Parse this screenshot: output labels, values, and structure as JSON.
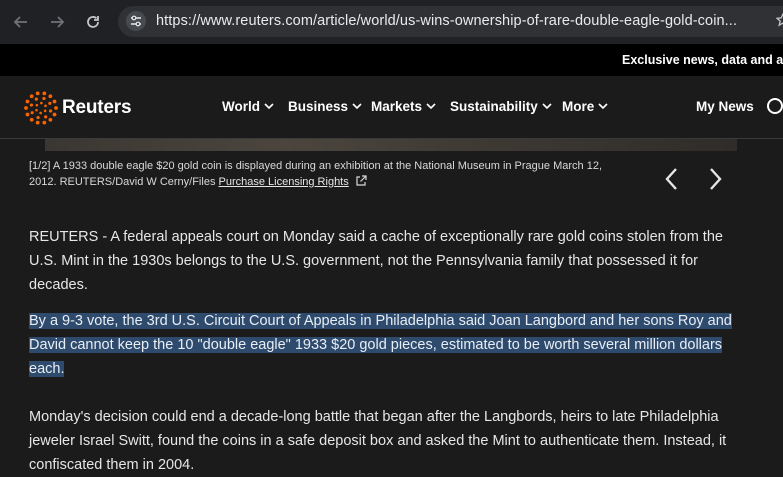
{
  "browser": {
    "url": "https://www.reuters.com/article/world/us-wins-ownership-of-rare-double-eagle-gold-coin..."
  },
  "promo": {
    "text": "Exclusive news, data and a"
  },
  "header": {
    "logo_text": "Reuters",
    "nav": [
      {
        "label": "World"
      },
      {
        "label": "Business"
      },
      {
        "label": "Markets"
      },
      {
        "label": "Sustainability"
      },
      {
        "label": "More"
      }
    ],
    "my_news": "My News"
  },
  "caption": {
    "text": "[1/2] A 1933 double eagle $20 gold coin is displayed during an exhibition at the National Museum in Prague March 12, 2012. REUTERS/David W Cerny/Files ",
    "link": "Purchase Licensing Rights"
  },
  "article": {
    "p1": "REUTERS - A federal appeals court on Monday said a cache of exceptionally rare gold coins stolen from the U.S. Mint in the 1930s belongs to the U.S. government, not the Pennsylvania family that possessed it for decades.",
    "p2": "By a 9-3 vote, the 3rd U.S. Circuit Court of Appeals in Philadelphia said Joan Langbord and her sons Roy and David cannot keep the 10 \"double eagle\" 1933 $20 gold pieces, estimated to be worth several million dollars each.",
    "p3": "Monday's decision could end a decade-long battle that began after the Langbords, heirs to late Philadelphia jeweler Israel Switt, found the coins in a safe deposit box and asked the Mint to authenticate them. Instead, it confiscated them in 2004."
  },
  "colors": {
    "page_bg": "#1b1b1b",
    "selection": "#2e4a6c",
    "brand_orange": "#fa6400"
  }
}
